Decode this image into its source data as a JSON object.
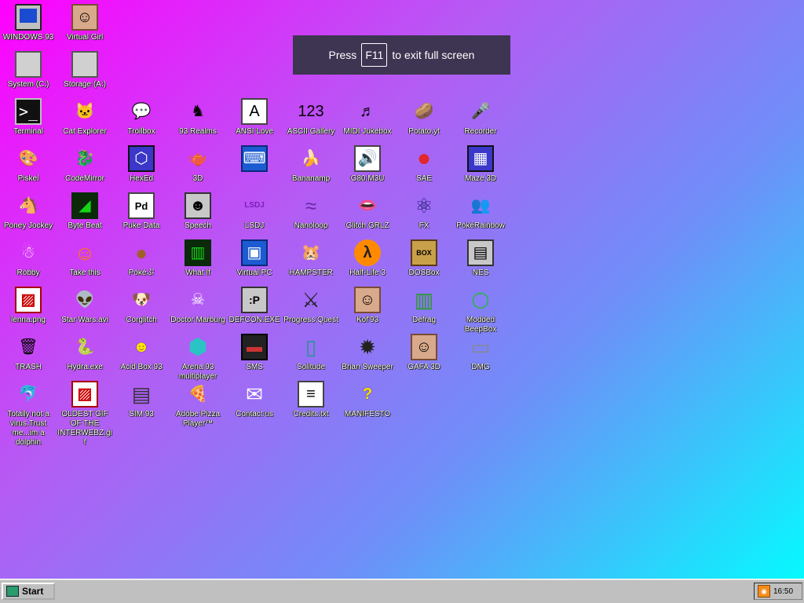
{
  "toast": {
    "prefix": "Press",
    "key": "F11",
    "suffix": "to exit full screen"
  },
  "icons": [
    {
      "label": "WINDOWS 93",
      "glyph": "",
      "style": "ic-monitor"
    },
    {
      "label": "Virtual Girl",
      "glyph": "☺",
      "style": "ic-face"
    },
    {
      "label": "System (C:)",
      "glyph": "",
      "style": "ic-drive"
    },
    {
      "label": "Storage (A:)",
      "glyph": "",
      "style": "ic-drive"
    },
    {
      "label": "Terminal",
      "glyph": ">_",
      "style": "ic-term"
    },
    {
      "label": "Cat Explorer",
      "glyph": "🐱",
      "style": ""
    },
    {
      "label": "Trollbox",
      "glyph": "💬",
      "style": ""
    },
    {
      "label": "93 Realms",
      "glyph": "♞",
      "style": ""
    },
    {
      "label": "ANSI Love",
      "glyph": "A",
      "style": "ic-doc"
    },
    {
      "label": "ASCII Gallery",
      "glyph": "123",
      "style": ""
    },
    {
      "label": "MIDI Jukebox",
      "glyph": "♬",
      "style": ""
    },
    {
      "label": "Potato.yt",
      "glyph": "🥔",
      "style": ""
    },
    {
      "label": "Recorder",
      "glyph": "🎤",
      "style": ""
    },
    {
      "label": "Piskel",
      "glyph": "🎨",
      "style": ""
    },
    {
      "label": "CodeMirror",
      "glyph": "🐉",
      "style": ""
    },
    {
      "label": "HexEd",
      "glyph": "⬡",
      "style": "ic-box"
    },
    {
      "label": "3D",
      "glyph": "🫖",
      "style": ""
    },
    {
      "label": "",
      "glyph": "⌨",
      "style": "ic-blue"
    },
    {
      "label": "Bananamp",
      "glyph": "🍌",
      "style": ""
    },
    {
      "label": "G80.M3U",
      "glyph": "🔊",
      "style": "ic-doc"
    },
    {
      "label": "SAE",
      "glyph": "●",
      "style": ""
    },
    {
      "label": "Maze 3D",
      "glyph": "▦",
      "style": "ic-box"
    },
    {
      "label": "Poney Jockey",
      "glyph": "🐴",
      "style": ""
    },
    {
      "label": "Byte Beat",
      "glyph": "◢",
      "style": ""
    },
    {
      "label": "Puke Data",
      "glyph": "Pd",
      "style": "ic-doc"
    },
    {
      "label": "Speech",
      "glyph": "☻",
      "style": "ic-gray"
    },
    {
      "label": "LSDJ",
      "glyph": "LSDJ",
      "style": ""
    },
    {
      "label": "Nanoloop",
      "glyph": "≈",
      "style": ""
    },
    {
      "label": "Glitch GRLZ",
      "glyph": "👄",
      "style": ""
    },
    {
      "label": "FX",
      "glyph": "⚛",
      "style": ""
    },
    {
      "label": "PokéRainbow",
      "glyph": "👥",
      "style": ""
    },
    {
      "label": "Robby",
      "glyph": "☃",
      "style": ""
    },
    {
      "label": "Take this",
      "glyph": "☺",
      "style": ""
    },
    {
      "label": "Pokéぷ",
      "glyph": "●",
      "style": ""
    },
    {
      "label": "What If",
      "glyph": "▥",
      "style": ""
    },
    {
      "label": "Virtual PC",
      "glyph": "▣",
      "style": "ic-blue"
    },
    {
      "label": "HAMPSTER",
      "glyph": "🐹",
      "style": ""
    },
    {
      "label": "Half-Life 3",
      "glyph": "λ",
      "style": ""
    },
    {
      "label": "DOSBox",
      "glyph": "BOX",
      "style": ""
    },
    {
      "label": "NES",
      "glyph": "▤",
      "style": "ic-gray"
    },
    {
      "label": "lenna.png",
      "glyph": "▨",
      "style": "ic-red"
    },
    {
      "label": "Star Wars.avi",
      "glyph": "👽",
      "style": ""
    },
    {
      "label": "Corglitch",
      "glyph": "🐶",
      "style": ""
    },
    {
      "label": "Doctor Marburg",
      "glyph": "☠",
      "style": ""
    },
    {
      "label": "DEFCON.EXE",
      "glyph": ":P",
      "style": "ic-gray"
    },
    {
      "label": "Progress Quest",
      "glyph": "⚔",
      "style": ""
    },
    {
      "label": "Kof'93",
      "glyph": "☺",
      "style": "ic-face"
    },
    {
      "label": "Defrag",
      "glyph": "▥",
      "style": ""
    },
    {
      "label": "Modded BeepBox",
      "glyph": "◯",
      "style": "ic-green"
    },
    {
      "label": "TRASH",
      "glyph": "🗑",
      "style": ""
    },
    {
      "label": "Hydra.exe",
      "glyph": "🐍",
      "style": ""
    },
    {
      "label": "Acid Box 93",
      "glyph": "☻",
      "style": "ic-yellow"
    },
    {
      "label": "Arena 93 multiplayer",
      "glyph": "⬢",
      "style": ""
    },
    {
      "label": "SMS",
      "glyph": "▬",
      "style": ""
    },
    {
      "label": "Solitude",
      "glyph": "▯",
      "style": ""
    },
    {
      "label": "Brian Sweeper",
      "glyph": "✹",
      "style": ""
    },
    {
      "label": "GAFA 3D",
      "glyph": "☺",
      "style": "ic-face"
    },
    {
      "label": "DMG",
      "glyph": "▭",
      "style": ""
    },
    {
      "label": "Totally not a virus.Trust me...im a dolphin",
      "glyph": "🐬",
      "style": ""
    },
    {
      "label": "OLDEST GIF OF THE INTERWEBZ.gif",
      "glyph": "▨",
      "style": "ic-red"
    },
    {
      "label": "SIM 93",
      "glyph": "▤",
      "style": ""
    },
    {
      "label": "Adobe Pizza Player™",
      "glyph": "🍕",
      "style": ""
    },
    {
      "label": "Contact us",
      "glyph": "✉",
      "style": ""
    },
    {
      "label": "Credits.txt",
      "glyph": "≡",
      "style": "ic-doc"
    },
    {
      "label": "MANIFESTO",
      "glyph": "?",
      "style": "ic-yellow"
    }
  ],
  "taskbar": {
    "start_label": "Start",
    "clock": "16:50"
  }
}
